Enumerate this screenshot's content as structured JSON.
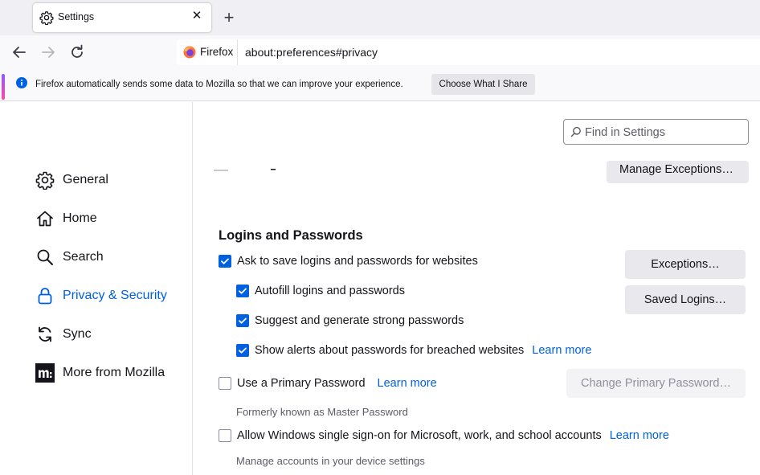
{
  "tab": {
    "title": "Settings",
    "icon": "gear-icon",
    "close_glyph": "✕"
  },
  "new_tab_glyph": "+",
  "nav": {
    "identity_label": "Firefox",
    "url": "about:preferences#privacy"
  },
  "notification": {
    "message": "Firefox automatically sends some data to Mozilla so that we can improve your experience.",
    "button": "Choose What I Share"
  },
  "sidebar": {
    "items": [
      {
        "label": "General",
        "icon": "gear-icon",
        "selected": false
      },
      {
        "label": "Home",
        "icon": "home-icon",
        "selected": false
      },
      {
        "label": "Search",
        "icon": "search-icon",
        "selected": false
      },
      {
        "label": "Privacy & Security",
        "icon": "lock-icon",
        "selected": true
      },
      {
        "label": "Sync",
        "icon": "sync-icon",
        "selected": false
      },
      {
        "label": "More from Mozilla",
        "icon": "mozilla-logo-icon",
        "selected": false
      }
    ]
  },
  "search": {
    "placeholder": "Find in Settings"
  },
  "partial_button": "Manage Exceptions…",
  "logins": {
    "title": "Logins and Passwords",
    "ask_save": "Ask to save logins and passwords for websites",
    "autofill": "Autofill logins and passwords",
    "suggest": "Suggest and generate strong passwords",
    "alerts": "Show alerts about passwords for breached websites",
    "learn_more": "Learn more",
    "exceptions_button": "Exceptions…",
    "saved_logins_button": "Saved Logins…",
    "primary_password": "Use a Primary Password",
    "change_primary_button": "Change Primary Password…",
    "formerly": "Formerly known as Master Password",
    "sso": "Allow Windows single sign-on for Microsoft, work, and school accounts",
    "sso_sub": "Manage accounts in your device settings"
  },
  "colors": {
    "accent": "#0061e0",
    "checkbox_checked": "#0061e0",
    "sidebar_selected": "#0061e0"
  }
}
